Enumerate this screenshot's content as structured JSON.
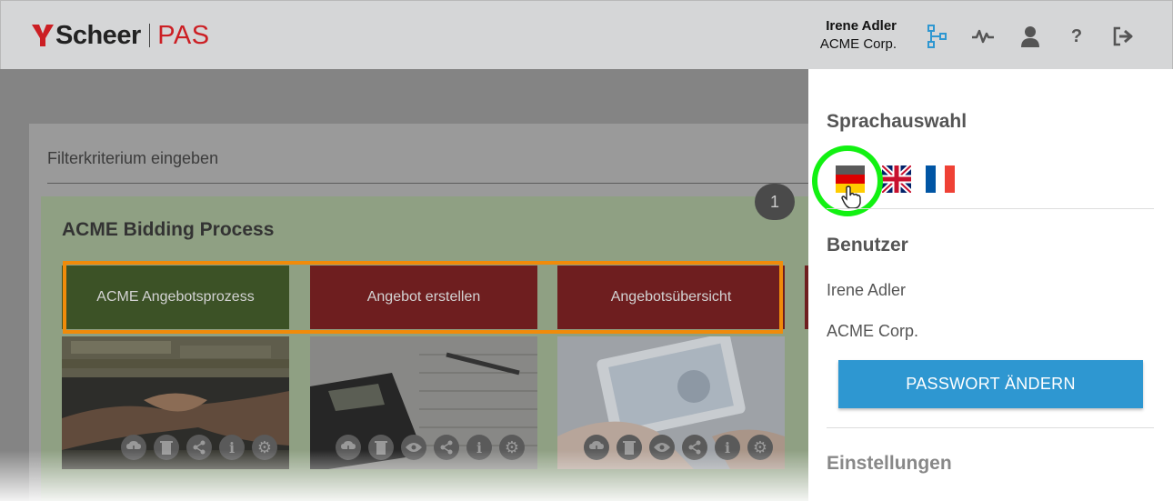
{
  "header": {
    "brand": "Scheer",
    "product": "PAS",
    "user_name": "Irene Adler",
    "company": "ACME Corp.",
    "icons": [
      "process-modeler-icon",
      "activity-icon",
      "user-icon",
      "help-icon",
      "logout-icon"
    ],
    "accent_color": "#2e97d1"
  },
  "main": {
    "filter_placeholder": "Filterkriterium eingeben",
    "group_title": "ACME Bidding Process",
    "tiles": [
      {
        "label": "ACME Angebotsprozess",
        "color": "#3c5226"
      },
      {
        "label": "Angebot erstellen",
        "color": "#6e1e1f"
      },
      {
        "label": "Angebotsübersicht",
        "color": "#6e1e1f"
      }
    ],
    "badge_count": "1",
    "tile_actions": [
      [
        "download-icon",
        "delete-icon",
        "share-icon",
        "info-icon",
        "settings-icon"
      ],
      [
        "download-icon",
        "delete-icon",
        "view-icon",
        "share-icon",
        "info-icon",
        "settings-icon"
      ],
      [
        "download-icon",
        "delete-icon",
        "view-icon",
        "share-icon",
        "info-icon",
        "settings-icon"
      ]
    ]
  },
  "drawer": {
    "language_title": "Sprachauswahl",
    "languages": [
      "german-flag-icon",
      "uk-flag-icon",
      "french-flag-icon"
    ],
    "user_title": "Benutzer",
    "user_name": "Irene Adler",
    "company": "ACME Corp.",
    "change_password": "PASSWORT ÄNDERN",
    "settings_title": "Einstellungen"
  },
  "highlight_colors": {
    "tiles_outline": "#f08b0a",
    "flag_ring": "#12f112"
  }
}
